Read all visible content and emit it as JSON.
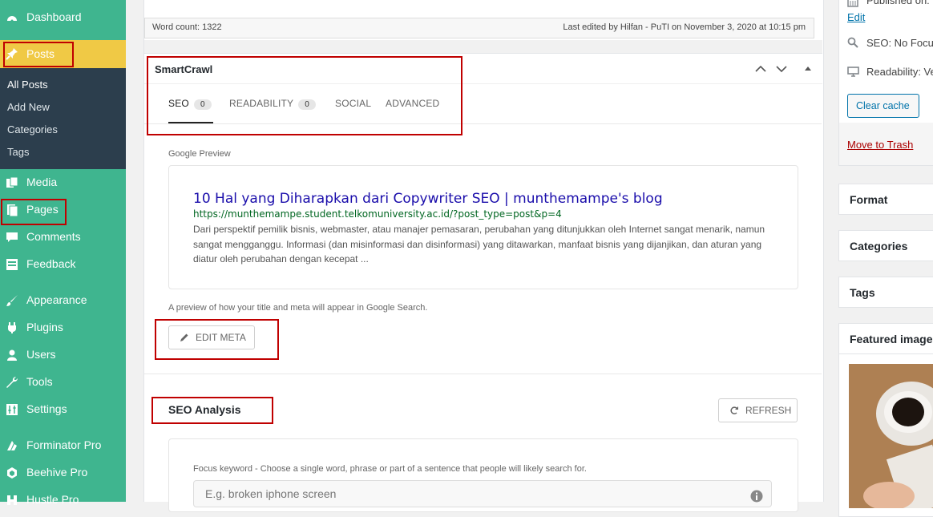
{
  "sidebar": {
    "items": {
      "dashboard": "Dashboard",
      "posts": "Posts",
      "media": "Media",
      "pages": "Pages",
      "comments": "Comments",
      "feedback": "Feedback",
      "appearance": "Appearance",
      "plugins": "Plugins",
      "users": "Users",
      "tools": "Tools",
      "settings": "Settings",
      "forminator": "Forminator Pro",
      "beehive": "Beehive Pro",
      "hustle": "Hustle Pro"
    },
    "posts_submenu": {
      "all_posts": "All Posts",
      "add_new": "Add New",
      "categories": "Categories",
      "tags": "Tags"
    }
  },
  "editor_footer": {
    "word_count": "Word count: 1322",
    "last_edited": "Last edited by Hilfan - PuTI on November 3, 2020 at 10:15 pm"
  },
  "smartcrawl": {
    "title": "SmartCrawl",
    "tabs": {
      "seo": {
        "label": "SEO",
        "count": "0"
      },
      "readability": {
        "label": "READABILITY",
        "count": "0"
      },
      "social": {
        "label": "SOCIAL"
      },
      "advanced": {
        "label": "ADVANCED"
      }
    },
    "google_preview_label": "Google Preview",
    "preview": {
      "title": "10 Hal yang Diharapkan dari Copywriter SEO | munthemampe's blog",
      "url": "https://munthemampe.student.telkomuniversity.ac.id/?post_type=post&p=4",
      "description": "Dari perspektif pemilik bisnis, webmaster, atau manajer pemasaran, perubahan yang ditunjukkan oleh Internet sangat menarik, namun sangat mengganggu. Informasi (dan misinformasi dan disinformasi) yang ditawarkan, manfaat bisnis yang dijanjikan, dan aturan yang diatur oleh perubahan dengan kecepat ..."
    },
    "preview_note": "A preview of how your title and meta will appear in Google Search.",
    "edit_meta_label": "EDIT META",
    "seo_analysis_title": "SEO Analysis",
    "refresh_label": "REFRESH",
    "focus_keyword_label": "Focus keyword - Choose a single word, phrase or part of a sentence that people will likely search for.",
    "focus_keyword_placeholder": "E.g. broken iphone screen"
  },
  "publish_box": {
    "published_on": "Published on:",
    "edit_link": "Edit",
    "seo_status": "SEO: No Focu",
    "readability_status": "Readability: Ve",
    "clear_cache": "Clear cache",
    "move_to_trash": "Move to Trash"
  },
  "side_panels": {
    "format": "Format",
    "categories": "Categories",
    "tags": "Tags",
    "featured_image": "Featured image"
  },
  "colors": {
    "sidebar_bg": "#3fb58f",
    "submenu_bg": "#2c3e4d",
    "posts_highlight": "#f0c945",
    "annotation_red": "#c00000",
    "serp_title": "#1a0dab",
    "serp_url": "#006621"
  }
}
